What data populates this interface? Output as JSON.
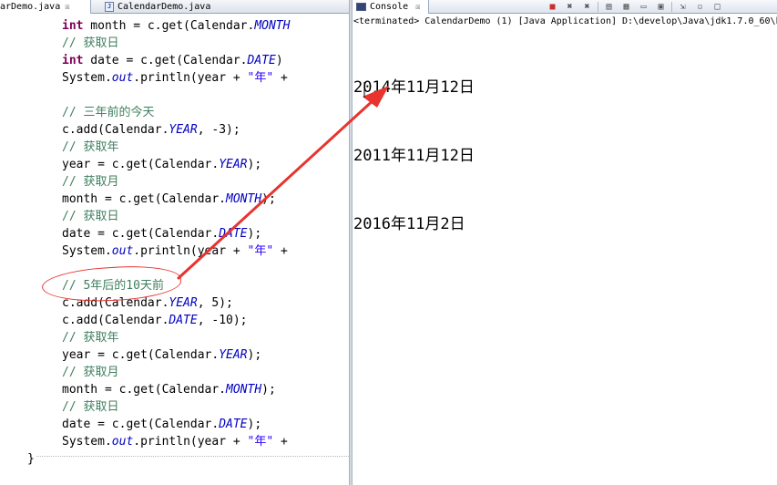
{
  "editor": {
    "tabs": [
      {
        "label": "arDemo.java",
        "close": "☒"
      },
      {
        "label": "CalendarDemo.java"
      }
    ],
    "lines": [
      {
        "kind": "a",
        "p1": "int",
        "p2": " month = c.get(Calendar.",
        "p3": "MONTH",
        "p4": ""
      },
      {
        "kind": "c",
        "text": "// 获取日"
      },
      {
        "kind": "a",
        "p1": "int",
        "p2": " date = c.get(Calendar.",
        "p3": "DATE",
        "p4": ")"
      },
      {
        "kind": "p",
        "p1": "System.",
        "p2": "out",
        "p3": ".println(year + ",
        "p4": "\"年\"",
        "p5": " +"
      },
      {
        "kind": "e"
      },
      {
        "kind": "c",
        "text": "// 三年前的今天"
      },
      {
        "kind": "f",
        "p1": "c.add(Calendar.",
        "p2": "YEAR",
        "p3": ", -3);"
      },
      {
        "kind": "c",
        "text": "// 获取年"
      },
      {
        "kind": "f",
        "p1": "year = c.get(Calendar.",
        "p2": "YEAR",
        "p3": ");"
      },
      {
        "kind": "c",
        "text": "// 获取月"
      },
      {
        "kind": "f",
        "p1": "month = c.get(Calendar.",
        "p2": "MONTH",
        "p3": ");"
      },
      {
        "kind": "c",
        "text": "// 获取日"
      },
      {
        "kind": "f",
        "p1": "date = c.get(Calendar.",
        "p2": "DATE",
        "p3": ");"
      },
      {
        "kind": "p",
        "p1": "System.",
        "p2": "out",
        "p3": ".println(year + ",
        "p4": "\"年\"",
        "p5": " +"
      },
      {
        "kind": "e"
      },
      {
        "kind": "c",
        "text": "// 5年后的10天前"
      },
      {
        "kind": "f",
        "p1": "c.add(Calendar.",
        "p2": "YEAR",
        "p3": ", 5);"
      },
      {
        "kind": "f",
        "p1": "c.add(Calendar.",
        "p2": "DATE",
        "p3": ", -10);"
      },
      {
        "kind": "c",
        "text": "// 获取年"
      },
      {
        "kind": "f",
        "p1": "year = c.get(Calendar.",
        "p2": "YEAR",
        "p3": ");"
      },
      {
        "kind": "c",
        "text": "// 获取月"
      },
      {
        "kind": "f",
        "p1": "month = c.get(Calendar.",
        "p2": "MONTH",
        "p3": ");"
      },
      {
        "kind": "c",
        "text": "// 获取日"
      },
      {
        "kind": "f",
        "p1": "date = c.get(Calendar.",
        "p2": "DATE",
        "p3": ");"
      },
      {
        "kind": "p",
        "p1": "System.",
        "p2": "out",
        "p3": ".println(year + ",
        "p4": "\"年\"",
        "p5": " +"
      }
    ],
    "closing_brace": "}"
  },
  "console": {
    "tab_label": "Console",
    "close": "☒",
    "status": "<terminated> CalendarDemo (1) [Java Application] D:\\develop\\Java\\jdk1.7.0_60\\b",
    "output": [
      "2014年11月12日",
      "2011年11月12日",
      "2016年11月2日"
    ],
    "toolbar_icons": [
      "stop-icon",
      "remove-launch-icon",
      "remove-all-icon",
      "scroll-lock-icon",
      "clear-console-icon",
      "pin-console-icon",
      "display-selected-icon",
      "open-console-icon",
      "minimize-icon",
      "maximize-icon"
    ]
  },
  "colors": {
    "keyword": "#7f0055",
    "field": "#0000c0",
    "string": "#2a00ff",
    "comment": "#3f7f5f",
    "annotation": "#e8332f"
  }
}
